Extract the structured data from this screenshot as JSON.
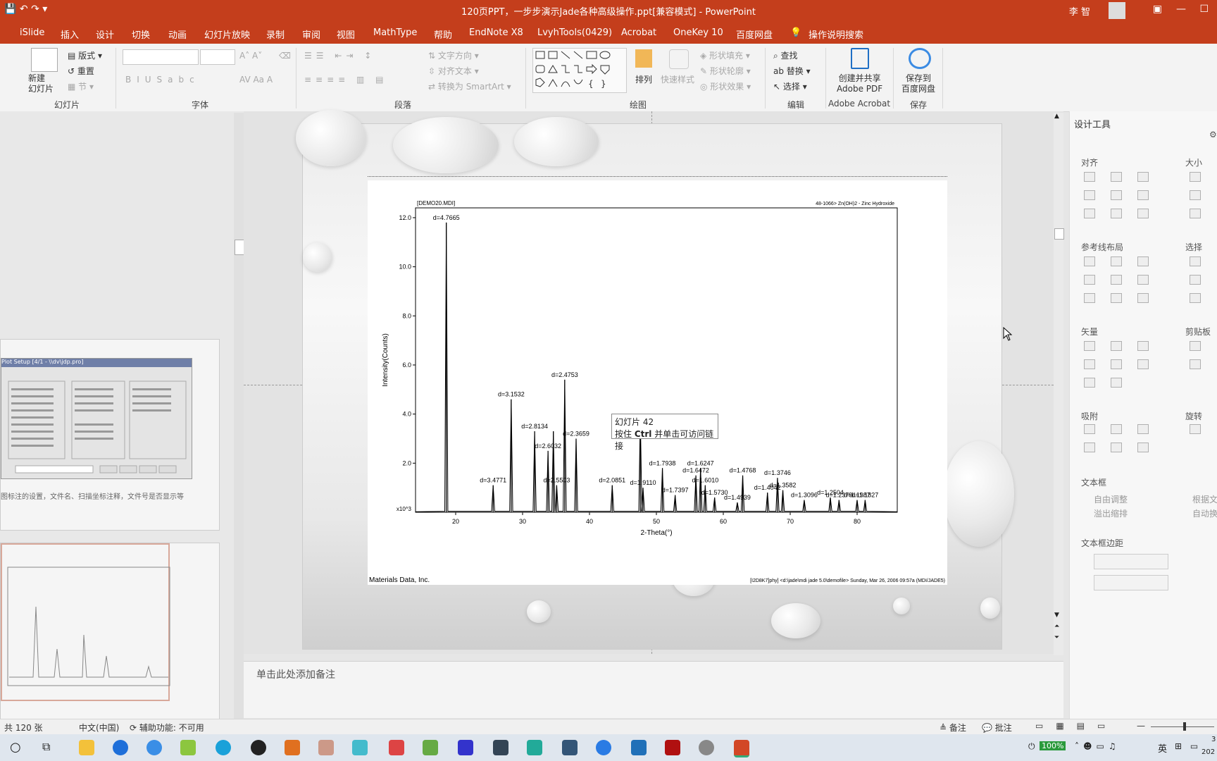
{
  "window": {
    "title": "120页PPT，一步步演示Jade各种高级操作.ppt[兼容模式] - PowerPoint",
    "user": "李 智"
  },
  "tabs": [
    "iSlide",
    "插入",
    "设计",
    "切换",
    "动画",
    "幻灯片放映",
    "录制",
    "审阅",
    "视图",
    "MathType",
    "帮助",
    "EndNote X8",
    "LvyhTools(0429)",
    "Acrobat",
    "OneKey 10",
    "百度网盘",
    "操作说明搜索"
  ],
  "ribbon": {
    "slides": {
      "new": "新建\n幻灯片",
      "layout": "版式",
      "reset": "重置",
      "section": "节",
      "label": "幻灯片"
    },
    "font": {
      "label": "字体"
    },
    "paragraph": {
      "text_dir": "文字方向",
      "align_text": "对齐文本",
      "smartart": "转换为 SmartArt",
      "label": "段落"
    },
    "drawing": {
      "arrange": "排列",
      "quick_styles": "快速样式",
      "fill": "形状填充",
      "outline": "形状轮廓",
      "effects": "形状效果",
      "label": "绘图"
    },
    "editing": {
      "find": "查找",
      "replace": "替换",
      "select": "选择",
      "label": "编辑"
    },
    "acrobat": {
      "create": "创建并共享\nAdobe PDF",
      "label": "Adobe Acrobat"
    },
    "save": {
      "btn": "保存到\n百度网盘",
      "label": "保存"
    }
  },
  "design_pane": {
    "title": "设计工具",
    "sections": [
      "对齐",
      "大小",
      "参考线布局",
      "选择",
      "矢量",
      "剪贴板",
      "吸附",
      "旋转",
      "文本框",
      "文本框边距"
    ],
    "textbox": {
      "auto": "自由调整",
      "overflow": "溢出缩排",
      "fit": "根据文",
      "autowrap": "自动换"
    }
  },
  "thumbnail": {
    "caption": "图标注的设置，文件名、扫描坐标注释，文件号是否显示等",
    "dialog_title": "Plot Setup [4/1 - \\\\dv\\jdp.pro]"
  },
  "tooltip": {
    "line1": "幻灯片 42",
    "line2_pre": "按住 ",
    "line2_key": "Ctrl",
    "line2_post": " 并单击可访问链接"
  },
  "notes_placeholder": "单击此处添加备注",
  "status": {
    "slide": "共 120 张",
    "lang": "中文(中国)",
    "access": "辅助功能: 不可用",
    "notes": "备注",
    "comments": "批注"
  },
  "taskbar": {
    "battery": "100%",
    "ime": "英",
    "year": "202",
    "day": "3"
  },
  "chart_data": {
    "type": "line",
    "title_left": "[DEMO20.MDI]",
    "title_right": "48-1066> Zn(OH)2 - Zinc Hydroxide",
    "xlabel": "2-Theta(°)",
    "ylabel": "Intensity(Counts)",
    "y_unit_label": "x10^3",
    "xlim": [
      14,
      86
    ],
    "ylim": [
      0,
      12.4
    ],
    "x_ticks": [
      20,
      30,
      40,
      50,
      60,
      70,
      80
    ],
    "y_ticks": [
      2.0,
      4.0,
      6.0,
      8.0,
      10.0,
      12.0
    ],
    "footer_left": "Materials Data, Inc.",
    "footer_right": "[I2D8K7]phy] <d:\\jade\\mdi jade 5.0\\demofile> Sunday, Mar 26, 2006 09:57a (MDI/JADE5)",
    "peaks": [
      {
        "x": 18.6,
        "y": 11.8,
        "label": "d=4.7665"
      },
      {
        "x": 25.6,
        "y": 1.1,
        "label": "d=3.4771"
      },
      {
        "x": 28.3,
        "y": 4.6,
        "label": "d=3.1532"
      },
      {
        "x": 31.8,
        "y": 3.3,
        "label": "d=2.8134"
      },
      {
        "x": 33.8,
        "y": 2.5,
        "label": "d=2.6032"
      },
      {
        "x": 34.6,
        "y": 3.3,
        "label": ""
      },
      {
        "x": 35.1,
        "y": 1.1,
        "label": "d=2.5503"
      },
      {
        "x": 36.3,
        "y": 5.4,
        "label": "d=2.4753"
      },
      {
        "x": 38.0,
        "y": 3.0,
        "label": "d=2.3659"
      },
      {
        "x": 43.4,
        "y": 1.1,
        "label": "d=2.0851"
      },
      {
        "x": 47.6,
        "y": 4.0,
        "label": ""
      },
      {
        "x": 48.0,
        "y": 1.0,
        "label": "d=1.9110"
      },
      {
        "x": 50.9,
        "y": 1.8,
        "label": "d=1.7938"
      },
      {
        "x": 52.8,
        "y": 0.7,
        "label": "d=1.7397"
      },
      {
        "x": 55.9,
        "y": 1.5,
        "label": "d=1.6472"
      },
      {
        "x": 56.6,
        "y": 1.8,
        "label": "d=1.6247"
      },
      {
        "x": 57.3,
        "y": 1.1,
        "label": "d=1.6010"
      },
      {
        "x": 58.7,
        "y": 0.6,
        "label": "d=1.5730"
      },
      {
        "x": 62.1,
        "y": 0.4,
        "label": "d=1.4939"
      },
      {
        "x": 62.9,
        "y": 1.5,
        "label": "d=1.4768"
      },
      {
        "x": 66.6,
        "y": 0.8,
        "label": "d=1.4042"
      },
      {
        "x": 68.1,
        "y": 1.4,
        "label": "d=1.3746"
      },
      {
        "x": 68.9,
        "y": 0.9,
        "label": "d=1.3582"
      },
      {
        "x": 72.1,
        "y": 0.5,
        "label": "d=1.3096"
      },
      {
        "x": 76.0,
        "y": 0.6,
        "label": "d=1.2504"
      },
      {
        "x": 77.3,
        "y": 0.5,
        "label": "d=1.2379"
      },
      {
        "x": 80.0,
        "y": 0.5,
        "label": "d=1.1987"
      },
      {
        "x": 81.2,
        "y": 0.5,
        "label": "d=1.1827"
      }
    ]
  }
}
